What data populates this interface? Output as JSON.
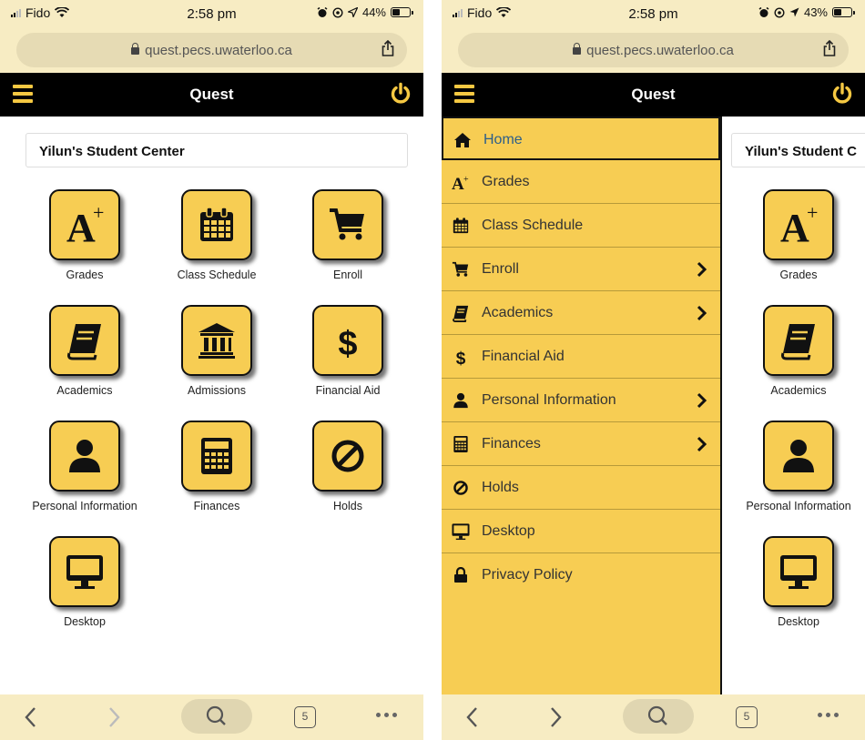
{
  "left": {
    "status": {
      "carrier": "Fido",
      "time": "2:58 pm",
      "battery": "44%",
      "battery_level": 0.44
    },
    "url": "quest.pecs.uwaterloo.ca",
    "header_title": "Quest",
    "student_center": "Yilun's Student Center",
    "tiles": [
      {
        "label": "Grades",
        "icon": "grades-icon"
      },
      {
        "label": "Class Schedule",
        "icon": "calendar-icon"
      },
      {
        "label": "Enroll",
        "icon": "cart-icon"
      },
      {
        "label": "Academics",
        "icon": "book-icon"
      },
      {
        "label": "Admissions",
        "icon": "institution-icon"
      },
      {
        "label": "Financial Aid",
        "icon": "dollar-icon"
      },
      {
        "label": "Personal Information",
        "icon": "person-icon"
      },
      {
        "label": "Finances",
        "icon": "calculator-icon"
      },
      {
        "label": "Holds",
        "icon": "ban-icon"
      },
      {
        "label": "Desktop",
        "icon": "desktop-icon"
      }
    ],
    "tabs_count": "5"
  },
  "right": {
    "status": {
      "carrier": "Fido",
      "time": "2:58 pm",
      "battery": "43%",
      "battery_level": 0.43
    },
    "url": "quest.pecs.uwaterloo.ca",
    "header_title": "Quest",
    "student_center": "Yilun's Student C",
    "menu": [
      {
        "label": "Home",
        "icon": "home-icon",
        "active": true,
        "submenu": false
      },
      {
        "label": "Grades",
        "icon": "grades-icon",
        "submenu": false
      },
      {
        "label": "Class Schedule",
        "icon": "calendar-icon",
        "submenu": false
      },
      {
        "label": "Enroll",
        "icon": "cart-icon",
        "submenu": true
      },
      {
        "label": "Academics",
        "icon": "book-icon",
        "submenu": true
      },
      {
        "label": "Financial Aid",
        "icon": "dollar-icon",
        "submenu": false
      },
      {
        "label": "Personal Information",
        "icon": "person-icon",
        "submenu": true
      },
      {
        "label": "Finances",
        "icon": "calculator-icon",
        "submenu": true
      },
      {
        "label": "Holds",
        "icon": "ban-icon",
        "submenu": false
      },
      {
        "label": "Desktop",
        "icon": "desktop-icon",
        "submenu": false
      },
      {
        "label": "Privacy Policy",
        "icon": "lock-icon",
        "submenu": false
      }
    ],
    "tiles": [
      {
        "label": "Grades",
        "icon": "grades-icon"
      },
      {
        "label": "Academics",
        "icon": "book-icon"
      },
      {
        "label": "Personal Information",
        "icon": "person-icon"
      },
      {
        "label": "Desktop",
        "icon": "desktop-icon"
      }
    ],
    "tabs_count": "5"
  },
  "colors": {
    "accent": "#f7cd53",
    "header": "#000000",
    "browser": "#f7ecc3",
    "power": "#f5c842"
  }
}
